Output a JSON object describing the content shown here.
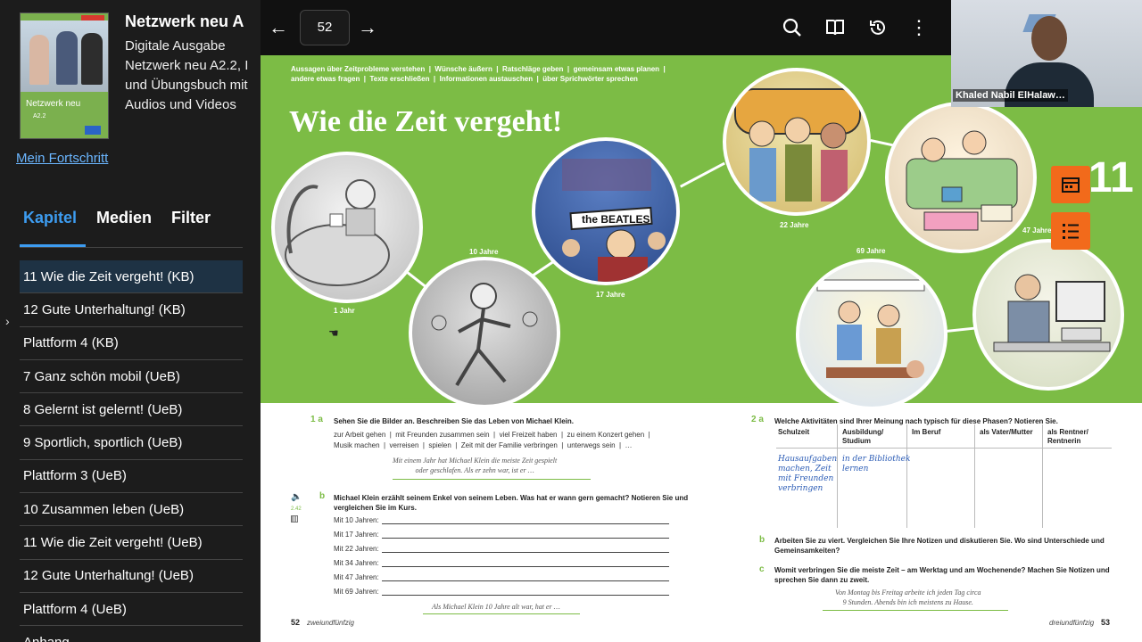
{
  "sidebar": {
    "cover": {
      "title": "Netzwerk neu",
      "level": "A2.2"
    },
    "book_title": "Netzwerk neu A",
    "book_desc": "Digitale Ausgabe\nNetzwerk neu A2.2, I\nund Übungsbuch mit\nAudios und Videos",
    "progress_link": "Mein Fortschritt",
    "tabs": [
      "Kapitel",
      "Medien",
      "Filter"
    ],
    "chapters": [
      "11 Wie die Zeit vergeht! (KB)",
      "12 Gute Unterhaltung! (KB)",
      "Plattform 4 (KB)",
      "7 Ganz schön mobil (UeB)",
      "8 Gelernt ist gelernt! (UeB)",
      "9 Sportlich, sportlich (UeB)",
      "Plattform 3 (UeB)",
      "10 Zusammen leben (UeB)",
      "11 Wie die Zeit vergeht! (UeB)",
      "12 Gute Unterhaltung! (UeB)",
      "Plattform 4 (UeB)",
      "Anhang"
    ]
  },
  "toolbar": {
    "page": "52",
    "back_icon": "←",
    "forward_icon": "→",
    "search_icon": "⌕",
    "book_icon": "📖",
    "history_icon": "↺",
    "more_icon": "⋮"
  },
  "page": {
    "topics": "Aussagen über Zeitprobleme verstehen  |  Wünsche äußern  |  Ratschläge geben  |  gemeinsam etwas planen  |\nandere etwas fragen  |  Texte erschließen  |  Informationen austauschen  |  über Sprichwörter sprechen",
    "headline": "Wie die Zeit vergeht!",
    "chapter_number": "11",
    "ages": [
      "1 Jahr",
      "10 Jahre",
      "17 Jahre",
      "22 Jahre",
      "47 Jahre",
      "69 Jahre"
    ],
    "beatles_sign": "the BEATLES",
    "ex1a_num": "1  a",
    "ex1a_text": "Sehen Sie die Bilder an. Beschreiben Sie das Leben von Michael Klein.",
    "ex1a_words": "zur Arbeit gehen  |  mit Freunden zusammen sein  |  viel Freizeit haben  |  zu einem Konzert gehen  |\nMusik machen  |  verreisen  |  spielen  |  Zeit mit der Familie verbringen  |  unterwegs sein  |  …",
    "ex1a_hint": "Mit einem Jahr hat Michael Klein die meiste Zeit gespielt\noder geschlafen. Als er zehn war, ist er …",
    "ex1b_num": "b",
    "ex1b_track": "2.42",
    "ex1b_text": "Michael Klein erzählt seinem Enkel von seinem Leben. Was hat er wann gern gemacht? Notieren Sie und\nvergleichen Sie im Kurs.",
    "ex1b_lines": [
      "Mit 10 Jahren:",
      "Mit 17 Jahren:",
      "Mit 22 Jahren:",
      "Mit 34 Jahren:",
      "Mit 47 Jahren:",
      "Mit 69 Jahren:"
    ],
    "ex1b_hint": "Als Michael Klein 10 Jahre alt war, hat er …",
    "ex2a_num": "2  a",
    "ex2a_text": "Welche Aktivitäten sind Ihrer Meinung nach typisch für diese Phasen? Notieren Sie.",
    "table_headers": [
      "Schulzeit",
      "Ausbildung/\nStudium",
      "Im Beruf",
      "als Vater/Mutter",
      "als Rentner/\nRentnerin"
    ],
    "table_hand1": "Hausaufgaben\nmachen, Zeit\nmit Freunden\nverbringen",
    "table_hand2": "in der Bibliothek\nlernen",
    "ex2b_num": "b",
    "ex2b_text": "Arbeiten Sie zu viert. Vergleichen Sie Ihre Notizen und diskutieren Sie. Wo sind Unterschiede und\nGemeinsamkeiten?",
    "ex2c_num": "c",
    "ex2c_text": "Womit verbringen Sie die meiste Zeit – am Werktag und am Wochenende? Machen Sie Notizen und\nsprechen Sie dann zu zweit.",
    "ex2c_hint": "Von Montag bis Freitag arbeite ich jeden Tag circa\n9 Stunden. Abends bin ich meistens zu Hause.",
    "footer_left_num": "52",
    "footer_left_word": "zweiundfünfzig",
    "footer_right_word": "dreiundfünfzig",
    "footer_right_num": "53"
  },
  "webcam": {
    "name": "Khaled Nabil ElHalaw…"
  },
  "colors": {
    "green": "#7cbc45",
    "orange": "#f26a1b",
    "accent": "#3d9cf0"
  }
}
